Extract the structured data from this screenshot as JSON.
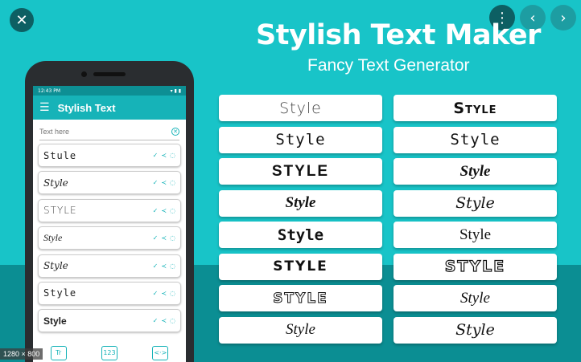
{
  "viewer": {
    "close_icon": "close-icon",
    "menu_icon": "more-vert-icon",
    "prev_icon": "chevron-left-icon",
    "next_icon": "chevron-right-icon",
    "size_badge": "1280 × 800"
  },
  "hero": {
    "title": "Stylish Text Maker",
    "subtitle": "Fancy Text Generator"
  },
  "phone": {
    "status_time": "12:43 PM",
    "status_icons": "▾ ▮ ▮",
    "app_title": "Stylish Text",
    "input_placeholder": "Text here",
    "items": [
      {
        "text": "Stule"
      },
      {
        "text": "Style"
      },
      {
        "text": "STYLE"
      },
      {
        "text": "Style"
      },
      {
        "text": "Style"
      },
      {
        "text": "Style"
      },
      {
        "text": "Style"
      }
    ],
    "bottom_buttons": [
      {
        "label": "Tr",
        "icon": "text-style-icon"
      },
      {
        "label": "123",
        "icon": "numbers-icon"
      },
      {
        "label": "<·>",
        "icon": "code-icon"
      }
    ]
  },
  "styles": [
    {
      "text": "Style"
    },
    {
      "text": "Style"
    },
    {
      "text": "Style"
    },
    {
      "text": "Style"
    },
    {
      "text": "STYLE"
    },
    {
      "text": "Style"
    },
    {
      "text": "Style"
    },
    {
      "text": "Style"
    },
    {
      "text": "Style"
    },
    {
      "text": "Style"
    },
    {
      "text": "STYLE"
    },
    {
      "text": "STYLE"
    },
    {
      "text": "STYLE"
    },
    {
      "text": "Style"
    },
    {
      "text": "Style"
    },
    {
      "text": "Style"
    }
  ],
  "colors": {
    "background": "#18c4c8",
    "background_dark": "#0b8e93",
    "app_bar": "#16b3b8"
  }
}
